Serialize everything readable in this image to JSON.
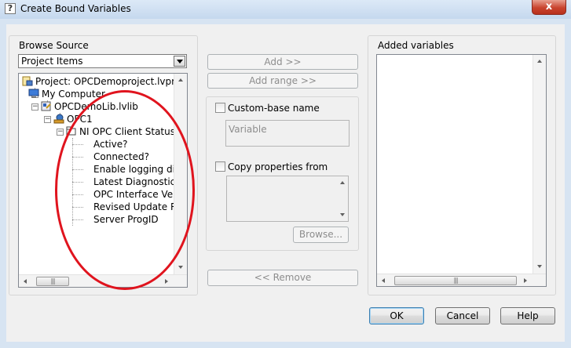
{
  "window": {
    "title": "Create Bound Variables",
    "close_glyph": "x",
    "app_icon_glyph": "?"
  },
  "browse": {
    "title": "Browse Source",
    "source_selected": "Project Items",
    "tree": [
      {
        "label": "Project: OPCDemoproject.lvproj",
        "icon": "project-icon"
      },
      {
        "label": "My Computer",
        "icon": "computer-icon"
      },
      {
        "label": "OPCDemoLib.lvlib",
        "icon": "library-icon"
      },
      {
        "label": "OPC1",
        "icon": "opc-server-icon"
      },
      {
        "label": "NI OPC Client Status",
        "icon": "folder-icon"
      },
      {
        "label": "Active?"
      },
      {
        "label": "Connected?"
      },
      {
        "label": "Enable logging diag"
      },
      {
        "label": "Latest Diagnostic Ir"
      },
      {
        "label": "OPC Interface Versi"
      },
      {
        "label": "Revised Update Rat"
      },
      {
        "label": "Server ProgID"
      }
    ]
  },
  "actions": {
    "add": "Add >>",
    "add_range": "Add range >>",
    "remove": "<< Remove",
    "custom_base_name": "Custom-base name",
    "variable_placeholder": "Variable",
    "copy_properties_from": "Copy properties from",
    "browse": "Browse..."
  },
  "added": {
    "title": "Added variables"
  },
  "footer": {
    "ok": "OK",
    "cancel": "Cancel",
    "help": "Help"
  },
  "colors": {
    "annotation": "#e0141e",
    "accent": "#3c7fb1"
  }
}
